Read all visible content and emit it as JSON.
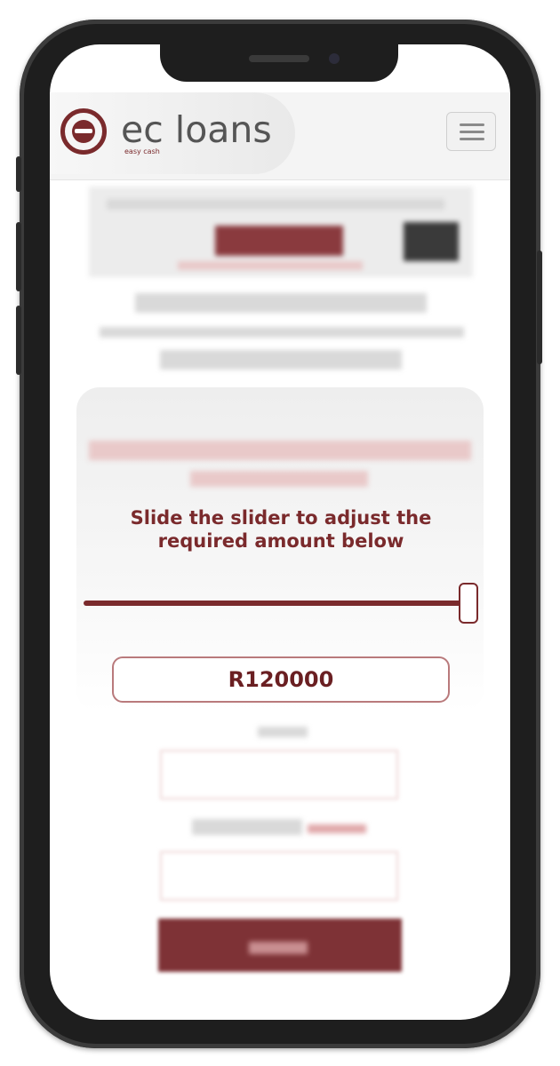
{
  "header": {
    "brand": "ec loans",
    "tagline": "easy cash"
  },
  "calculator": {
    "prompt": "Slide the slider to adjust the required amount below",
    "amount": "R120000",
    "slider_fraction": 1.0
  },
  "colors": {
    "brand": "#7a2a2c",
    "frame": "#1e1e1e"
  }
}
